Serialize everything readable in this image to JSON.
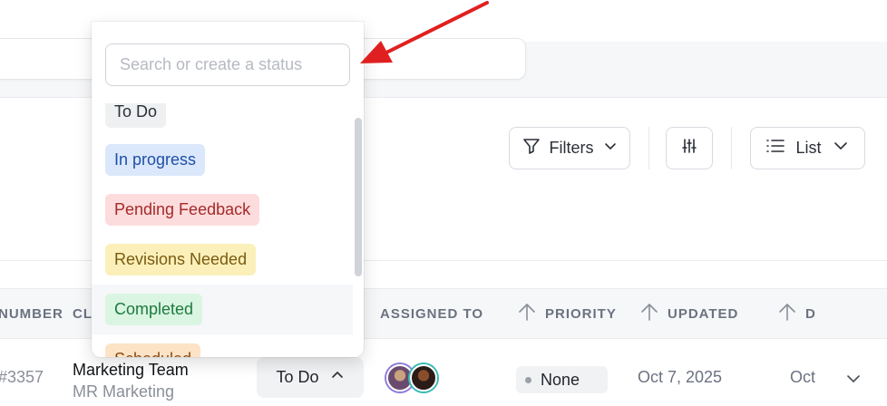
{
  "toolbar": {
    "filters_label": "Filters",
    "list_label": "List",
    "adjust_icon": "sliders-icon",
    "filter_icon": "funnel-icon",
    "list_icon": "list-icon"
  },
  "table": {
    "headers": {
      "number": "NUMBER",
      "client": "CL",
      "assigned": "ASSIGNED TO",
      "priority": "PRIORITY",
      "updated": "UPDATED",
      "due": "D"
    },
    "row": {
      "number": "#3357",
      "client_name": "Marketing Team",
      "client_sub": "MR Marketing",
      "status": "To Do",
      "priority": "None",
      "updated": "Oct 7, 2025",
      "due": "Oct"
    }
  },
  "status_dropdown": {
    "search_placeholder": "Search or create a status",
    "options": [
      {
        "label": "To Do",
        "bg": "#eef0f2",
        "fg": "#2b2f36"
      },
      {
        "label": "In progress",
        "bg": "#dbe8fb",
        "fg": "#1f4ea8"
      },
      {
        "label": "Pending Feedback",
        "bg": "#fcdcdc",
        "fg": "#a52a2a"
      },
      {
        "label": "Revisions Needed",
        "bg": "#fbf0b9",
        "fg": "#7a5a10"
      },
      {
        "label": "Completed",
        "bg": "#daf5e2",
        "fg": "#1e7a3e"
      },
      {
        "label": "Scheduled",
        "bg": "#fde3c6",
        "fg": "#8a4a12"
      }
    ]
  },
  "annotation": {
    "arrow_color": "#e02020"
  }
}
